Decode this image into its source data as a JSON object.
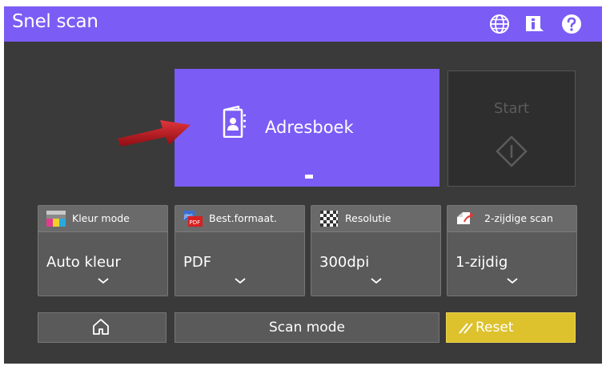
{
  "titlebar": {
    "title": "Snel scan",
    "icons": [
      "globe-icon",
      "info-icon",
      "help-icon"
    ]
  },
  "address_book": {
    "label": "Adresboek",
    "icon": "address-book-icon"
  },
  "start": {
    "label": "Start",
    "icon": "start-diamond-icon"
  },
  "tiles": [
    {
      "title": "Kleur mode",
      "value": "Auto kleur",
      "icon": "color-mode-icon"
    },
    {
      "title": "Best.formaat.",
      "value": "PDF",
      "icon": "file-format-icon"
    },
    {
      "title": "Resolutie",
      "value": "300dpi",
      "icon": "resolution-icon"
    },
    {
      "title": "2-zijdige scan",
      "value": "1-zijdig",
      "icon": "duplex-icon"
    }
  ],
  "bottom": {
    "home_icon": "home-icon",
    "scan_mode_label": "Scan mode",
    "reset_label": "Reset"
  },
  "colors": {
    "accent": "#7b5cf5",
    "panel_bg": "#3a3a3a",
    "tile_bg": "#5a5a5a",
    "reset": "#ddc22e",
    "arrow": "#c0141c"
  }
}
